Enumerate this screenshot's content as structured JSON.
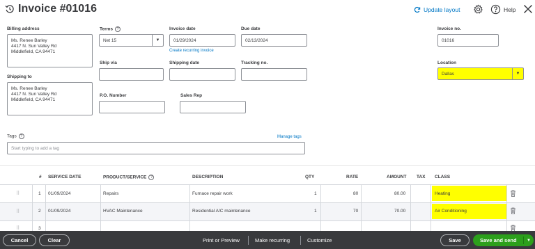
{
  "header": {
    "title": "Invoice #01016",
    "update_layout": "Update layout",
    "help": "Help"
  },
  "billing": {
    "label": "Billing address",
    "address": "Ms. Renee Barley\n4417 N. Sun Valley Rd\nMiddlefield, CA  94471"
  },
  "shipping_to": {
    "label": "Shipping to",
    "address": "Ms. Renee Barley\n4417 N. Sun Valley Rd\nMiddlefield, CA  94471"
  },
  "terms": {
    "label": "Terms",
    "value": "Net 15"
  },
  "invoice_date": {
    "label": "Invoice date",
    "value": "01/29/2024",
    "link": "Create recurring invoice"
  },
  "due_date": {
    "label": "Due date",
    "value": "02/13/2024"
  },
  "invoice_no": {
    "label": "Invoice no.",
    "value": "01016"
  },
  "ship_via": {
    "label": "Ship via",
    "value": ""
  },
  "shipping_date": {
    "label": "Shipping date",
    "value": ""
  },
  "tracking_no": {
    "label": "Tracking no.",
    "value": ""
  },
  "location": {
    "label": "Location",
    "value": "Dallas"
  },
  "po_number": {
    "label": "P.O. Number",
    "value": ""
  },
  "sales_rep": {
    "label": "Sales Rep",
    "value": ""
  },
  "tags": {
    "label": "Tags",
    "manage": "Manage tags",
    "placeholder": "Start typing to add a tag"
  },
  "table": {
    "headers": {
      "num": "#",
      "service_date": "SERVICE DATE",
      "product": "PRODUCT/SERVICE",
      "description": "DESCRIPTION",
      "qty": "QTY",
      "rate": "RATE",
      "amount": "AMOUNT",
      "tax": "TAX",
      "class": "CLASS"
    },
    "rows": [
      {
        "num": "1",
        "service_date": "01/09/2024",
        "product": "Repairs",
        "description": "Furnace repair work",
        "qty": "1",
        "rate": "80",
        "amount": "80.00",
        "class": "Heating"
      },
      {
        "num": "2",
        "service_date": "01/09/2024",
        "product": "HVAC Maintenance",
        "description": "Residential A/C maintenance",
        "qty": "1",
        "rate": "70",
        "amount": "70.00",
        "class": "Air Conditioning"
      },
      {
        "num": "3"
      }
    ]
  },
  "footer": {
    "cancel": "Cancel",
    "clear": "Clear",
    "print_preview": "Print or Preview",
    "make_recurring": "Make recurring",
    "customize": "Customize",
    "save": "Save",
    "save_and_send": "Save and send"
  },
  "colors": {
    "accent": "#0077c5",
    "highlight": "#ffff00",
    "footer_bg": "#393a3d",
    "primary_button": "#2ca01c"
  }
}
